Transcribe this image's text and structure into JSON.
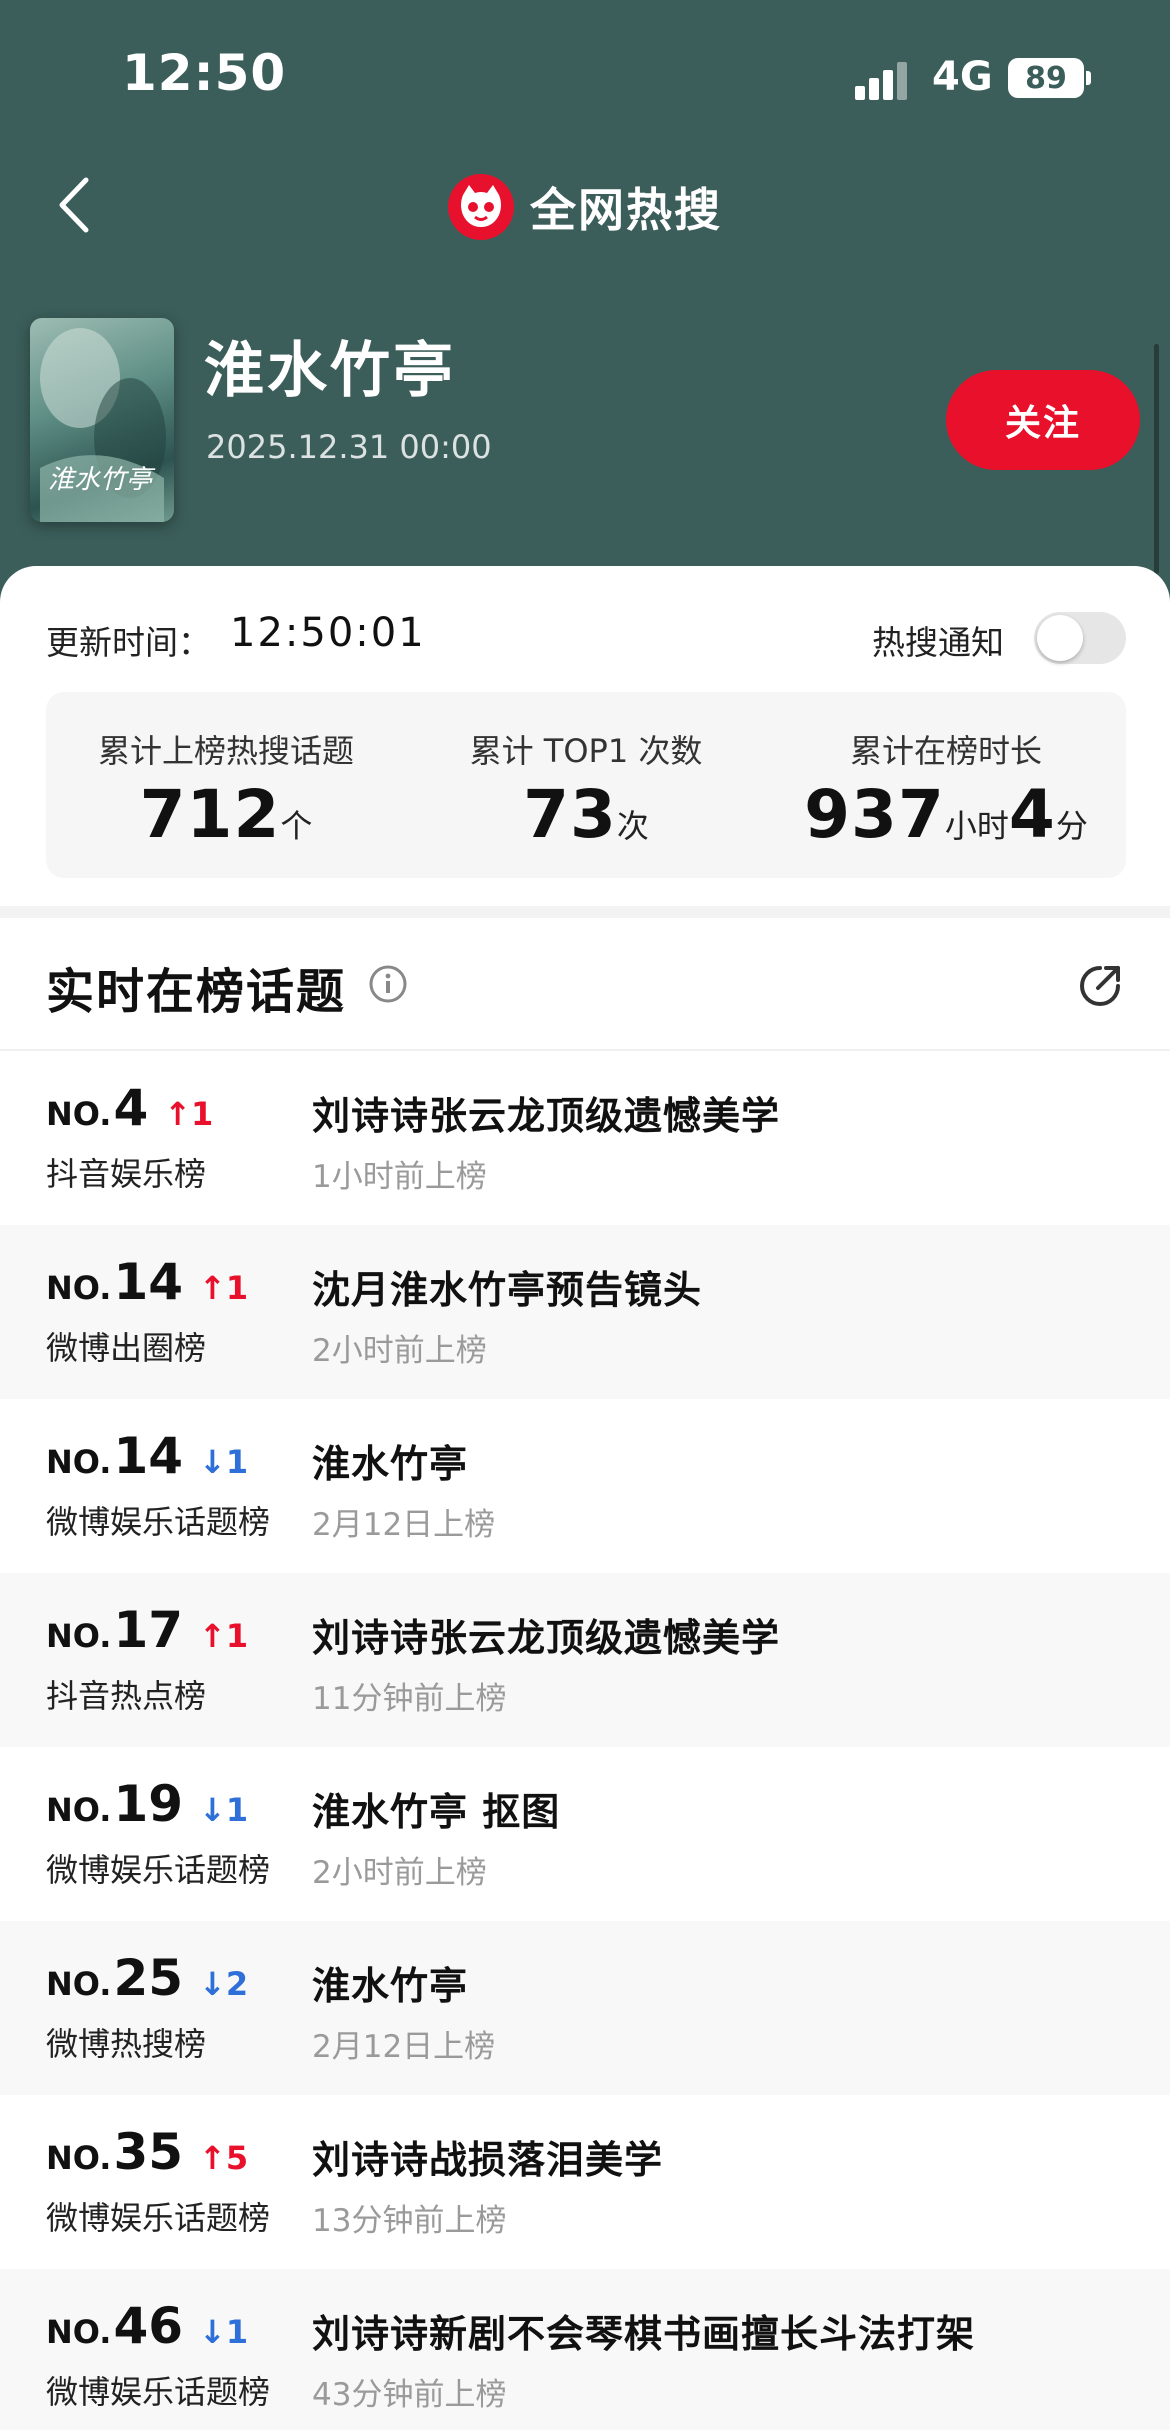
{
  "status_bar": {
    "time": "12:50",
    "network": "4G",
    "battery": "89"
  },
  "header": {
    "brand_title": "全网热搜"
  },
  "show": {
    "title": "淮水竹亭",
    "date": "2025.12.31 00:00",
    "follow_label": "关注"
  },
  "summary": {
    "update_label": "更新时间：",
    "update_time": "12:50:01",
    "notify_label": "热搜通知",
    "notify_enabled": false,
    "stats": [
      {
        "label": "累计上榜热搜话题",
        "value": "712",
        "unit": "个"
      },
      {
        "label": "累计 TOP1 次数",
        "value": "73",
        "unit": "次"
      },
      {
        "label": "累计在榜时长",
        "hours": "937",
        "hours_unit": "小时",
        "minutes": "4",
        "minutes_unit": "分"
      }
    ]
  },
  "realtime": {
    "title": "实时在榜话题",
    "rows": [
      {
        "no": "NO.",
        "rank": "4",
        "trend": "↑1",
        "board": "抖音娱乐榜",
        "topic": "刘诗诗张云龙顶级遗憾美学",
        "time": "1小时前上榜"
      },
      {
        "no": "NO.",
        "rank": "14",
        "trend": "↑1",
        "board": "微博出圈榜",
        "topic": "沈月淮水竹亭预告镜头",
        "time": "2小时前上榜"
      },
      {
        "no": "NO.",
        "rank": "14",
        "trend": "↓1",
        "board": "微博娱乐话题榜",
        "topic": "淮水竹亭",
        "time": "2月12日上榜"
      },
      {
        "no": "NO.",
        "rank": "17",
        "trend": "↑1",
        "board": "抖音热点榜",
        "topic": "刘诗诗张云龙顶级遗憾美学",
        "time": "11分钟前上榜"
      },
      {
        "no": "NO.",
        "rank": "19",
        "trend": "↓1",
        "board": "微博娱乐话题榜",
        "topic": "淮水竹亭 抠图",
        "time": "2小时前上榜"
      },
      {
        "no": "NO.",
        "rank": "25",
        "trend": "↓2",
        "board": "微博热搜榜",
        "topic": "淮水竹亭",
        "time": "2月12日上榜"
      },
      {
        "no": "NO.",
        "rank": "35",
        "trend": "↑5",
        "board": "微博娱乐话题榜",
        "topic": "刘诗诗战损落泪美学",
        "time": "13分钟前上榜"
      },
      {
        "no": "NO.",
        "rank": "46",
        "trend": "↓1",
        "board": "微博娱乐话题榜",
        "topic": "刘诗诗新剧不会琴棋书画擅长斗法打架",
        "time": "43分钟前上榜"
      }
    ]
  },
  "colors": {
    "header_bg": "#3b5e5a",
    "accent_red": "#e8102b",
    "trend_down": "#2f6fd8"
  }
}
